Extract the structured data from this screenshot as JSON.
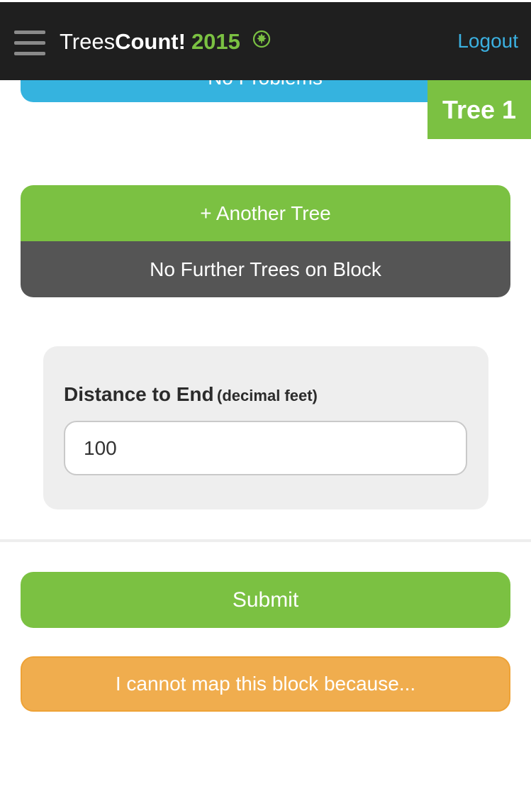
{
  "header": {
    "logo_trees": "Trees",
    "logo_count": "Count!",
    "logo_year": "2015",
    "logo_icon": "maple-leaf-circle-icon",
    "menu_icon": "hamburger-menu-icon",
    "logout_label": "Logout"
  },
  "previous_section": {
    "button_label": "No Problems"
  },
  "tree_tab": {
    "label": "Tree 1"
  },
  "tree_actions": {
    "another_tree_label": "+ Another Tree",
    "no_further_label": "No Further Trees on Block"
  },
  "distance": {
    "label": "Distance to End",
    "unit_hint": "(decimal feet)",
    "value": "100"
  },
  "actions": {
    "submit_label": "Submit",
    "cannot_map_label": "I cannot map this block because..."
  },
  "colors": {
    "brand_green": "#7bc142",
    "header_dark": "#1f1f1f",
    "link_blue": "#3bb0e0",
    "info_blue": "#35b3df",
    "warning_orange": "#f0ad4e",
    "dark_gray": "#555555"
  }
}
